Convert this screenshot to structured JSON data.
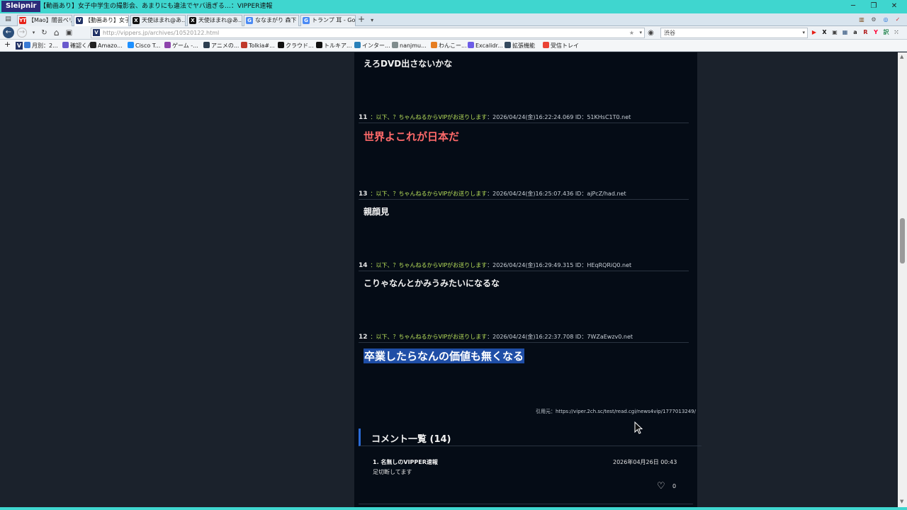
{
  "window": {
    "app_name": "Sleipnir",
    "title": "【動画あり】女子中学生の撮影会、あまりにも違法でヤバ過ぎる…：VIPPER速報",
    "minimize": "─",
    "maximize": "❐",
    "close": "✕"
  },
  "tabs": [
    {
      "label": "【Mao】闇芸ベリ...",
      "favicon": "YT",
      "color": "#e62117"
    },
    {
      "label": "【動画あり】女子...",
      "favicon": "V",
      "color": "#223366",
      "active": true
    },
    {
      "label": "天使ほまれ@あ...",
      "favicon": "X",
      "color": "#111111"
    },
    {
      "label": "天使ほまれ@あ...",
      "favicon": "X",
      "color": "#111111"
    },
    {
      "label": "ななまがり 森下 -...",
      "favicon": "G",
      "color": "#4a8af4"
    },
    {
      "label": "トランプ 耳 - Goo...",
      "favicon": "G",
      "color": "#4a8af4"
    }
  ],
  "new_tab": "+",
  "tab_menu": "▾",
  "nav": {
    "back": "←",
    "forward": "→",
    "reload": "↻",
    "home": "⌂",
    "url": "http://vippers.jp/archives/10520122.html",
    "url_favicon": "V",
    "bookmark_star": "★",
    "search_value": "渋谷"
  },
  "toolbar_icons": [
    {
      "name": "youtube-icon",
      "glyph": "▶",
      "color": "#e62117"
    },
    {
      "name": "x-icon",
      "glyph": "X",
      "color": "#111111"
    },
    {
      "name": "tv-icon",
      "glyph": "▣",
      "color": "#444444"
    },
    {
      "name": "calendar-icon",
      "glyph": "▦",
      "color": "#2c4f7a"
    },
    {
      "name": "amazon-icon",
      "glyph": "a",
      "color": "#222222"
    },
    {
      "name": "r-icon",
      "glyph": "R",
      "color": "#b01a1a"
    },
    {
      "name": "yahoo-icon",
      "glyph": "Y",
      "color": "#ff0033"
    },
    {
      "name": "translate-icon",
      "glyph": "訳",
      "color": "#2e8b57"
    },
    {
      "name": "grid-icon",
      "glyph": "⁙",
      "color": "#555555"
    }
  ],
  "right_window_icons": [
    {
      "name": "gift-icon",
      "glyph": "▥",
      "color": "#7a4a1a"
    },
    {
      "name": "settings-icon",
      "glyph": "⚙",
      "color": "#555555"
    },
    {
      "name": "refresh-icon",
      "glyph": "◎",
      "color": "#1e6fd9"
    },
    {
      "name": "alert-icon",
      "glyph": "✓",
      "color": "#d32f2f"
    }
  ],
  "bookmarks": [
    {
      "label": "V",
      "color": "#223366"
    },
    {
      "label": "月別：2...",
      "color": "#3a7bd5"
    },
    {
      "label": "確認くん",
      "color": "#6a5acd"
    },
    {
      "label": "Amazo...",
      "color": "#222222"
    },
    {
      "label": "Cisco T...",
      "color": "#1e90ff"
    },
    {
      "label": "ゲーム -...",
      "color": "#8e44ad"
    },
    {
      "label": "アニメの...",
      "color": "#2c3e50"
    },
    {
      "label": "Tolkia#...",
      "color": "#c0392b"
    },
    {
      "label": "クラウド...",
      "color": "#111111"
    },
    {
      "label": "トルキア...",
      "color": "#111111"
    },
    {
      "label": "インター...",
      "color": "#2980b9"
    },
    {
      "label": "nanjmu...",
      "color": "#7f8c8d"
    },
    {
      "label": "わんこー...",
      "color": "#e67e22"
    },
    {
      "label": "Excalidr...",
      "color": "#6c5ce7"
    },
    {
      "label": "拡張機能",
      "color": "#34495e"
    },
    {
      "label": "受信トレイ",
      "color": "#ea4335"
    }
  ],
  "posts": [
    {
      "type": "body",
      "text": "えろDVD出さないかな",
      "style": "normal"
    },
    {
      "type": "head",
      "num": "11",
      "name": "：以下、？ちゃんねるからVIPがお送りします",
      "meta": "：2026/04/24(金)16:22:24.069 ID：51KHsC1T0.net"
    },
    {
      "type": "body",
      "text": "世界よこれが日本だ",
      "style": "red"
    },
    {
      "type": "head",
      "num": "13",
      "name": "：以下、？ちゃんねるからVIPがお送りします",
      "meta": "：2026/04/24(金)16:25:07.436 ID：ajPcZ/had.net"
    },
    {
      "type": "body",
      "text": "親顔見",
      "style": "normal"
    },
    {
      "type": "head",
      "num": "14",
      "name": "：以下、？ちゃんねるからVIPがお送りします",
      "meta": "：2026/04/24(金)16:29:49.315 ID：HEqRQRiQ0.net"
    },
    {
      "type": "body",
      "text": "こりゃなんとかみうみたいになるな",
      "style": "normal"
    },
    {
      "type": "head",
      "num": "12",
      "name": "：以下、？ちゃんねるからVIPがお送りします",
      "meta": "：2026/04/24(金)16:22:37.708 ID：7WZaEwzv0.net"
    },
    {
      "type": "body",
      "text": "卒業したらなんの価値も無くなる",
      "style": "selected"
    }
  ],
  "quote_source": "引用元：https://viper.2ch.sc/test/read.cgi/news4vip/1777013249/",
  "comments": {
    "title": "コメント一覧 (14)",
    "items": [
      {
        "name": "1. 名無しのVIPPER速報",
        "date": "2026年04月26日 00:43",
        "text": "足切断してます",
        "likes": "0"
      }
    ]
  }
}
